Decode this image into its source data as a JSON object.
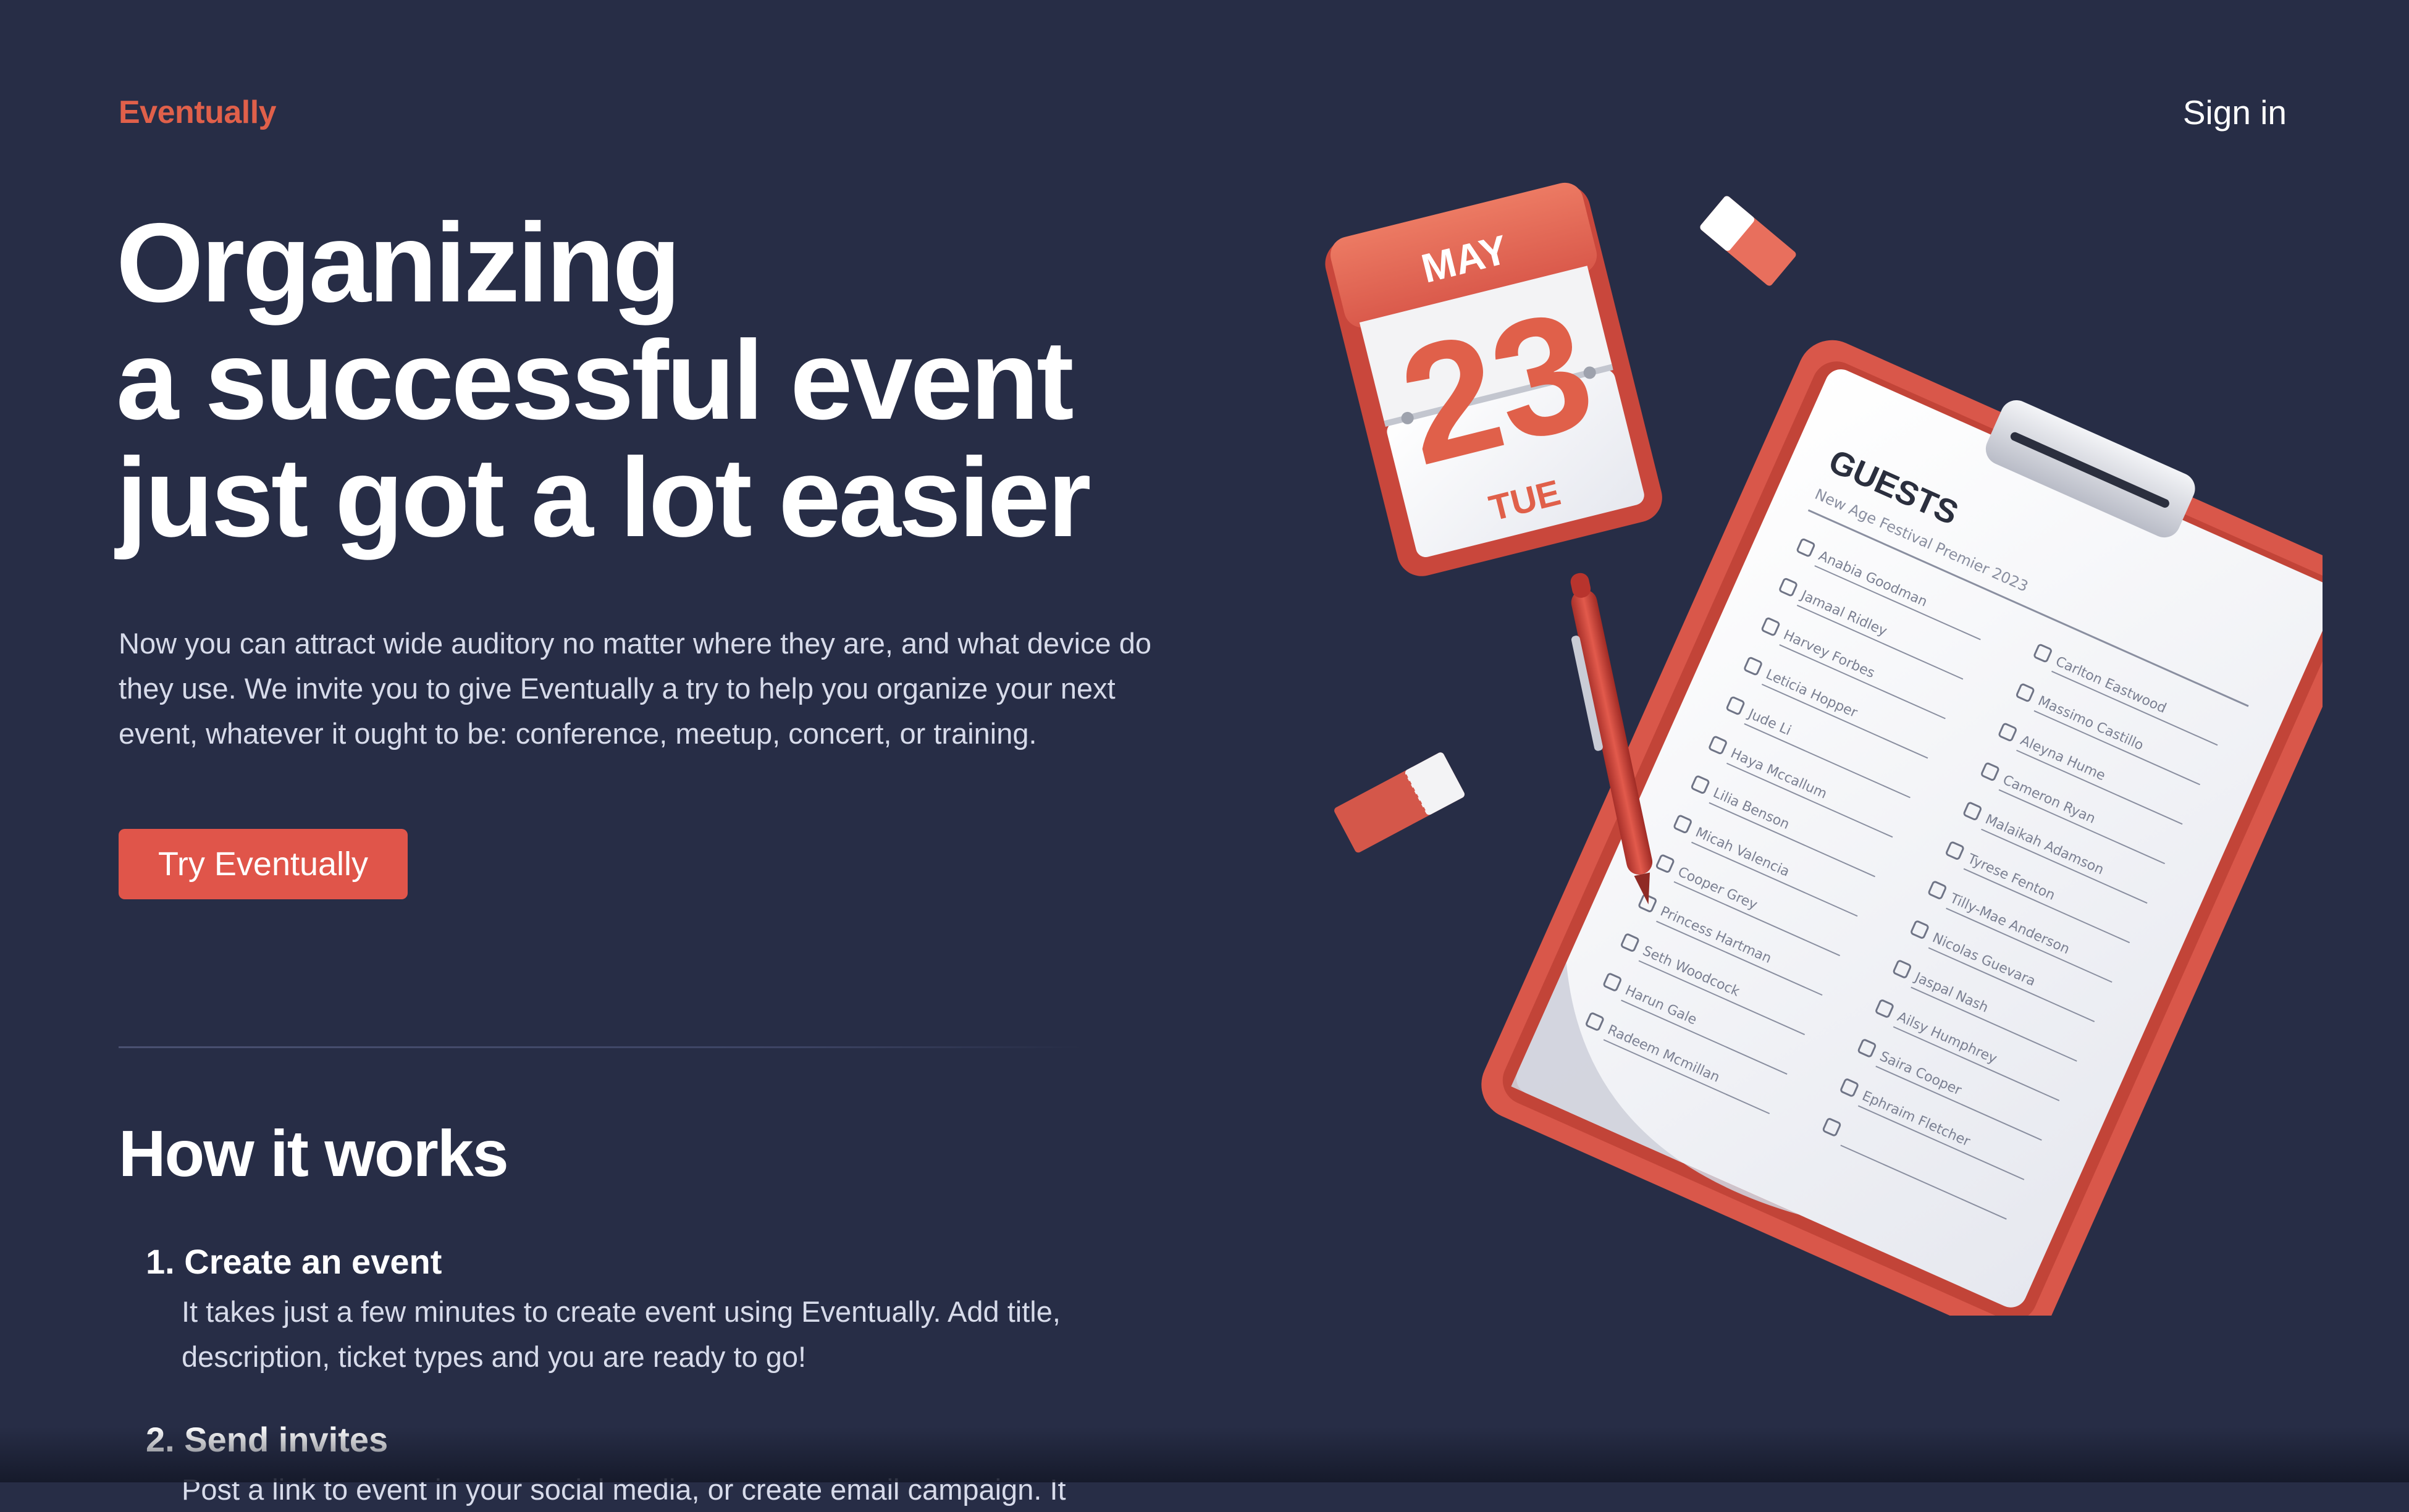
{
  "header": {
    "brand": "Eventually",
    "signin_label": "Sign in"
  },
  "hero": {
    "title_lines": [
      "Organizing",
      "a successful event",
      "just got a lot easier"
    ],
    "description": "Now you can attract wide auditory no matter where they are, and what device do they use. We invite you to give Eventually a try to help you organize your next event, whatever it ought to be: conference, meetup, concert, or training.",
    "cta_label": "Try Eventually"
  },
  "how_it_works": {
    "title": "How it works",
    "steps": [
      {
        "title": "1. Create an event",
        "description": "It takes just a few minutes to create event using Eventually. Add title, description, ticket types and you are ready to go!"
      },
      {
        "title": "2. Send invites",
        "description": "Post a link to event in your social media, or create email campaign. It"
      }
    ]
  },
  "illustration": {
    "calendar": {
      "month": "MAY",
      "day": "23",
      "weekday": "TUE"
    },
    "clipboard": {
      "heading": "GUESTS",
      "subheading": "New Age Festival Premier 2023",
      "left_column": [
        "Anabia Goodman",
        "Jamaal Ridley",
        "Harvey Forbes",
        "Leticia Hopper",
        "Jude Li",
        "Haya Mccallum",
        "Lilia Benson",
        "Micah Valencia",
        "Cooper Grey",
        "Princess Hartman",
        "Seth Woodcock",
        "Harun Gale",
        "Radeem Mcmillan"
      ],
      "right_column": [
        "Carlton Eastwood",
        "Massimo Castillo",
        "Aleyna Hume",
        "Cameron Ryan",
        "Malaikah Adamson",
        "Tyrese Fenton",
        "Tilly-Mae Anderson",
        "Nicolas Guevara",
        "Jaspal Nash",
        "Ailsy Humphrey",
        "Saira Cooper",
        "Ephraim Fletcher",
        ""
      ]
    },
    "colors": {
      "accent": "#e0554a",
      "background": "#272d46",
      "paper": "#f4f5f8"
    }
  }
}
